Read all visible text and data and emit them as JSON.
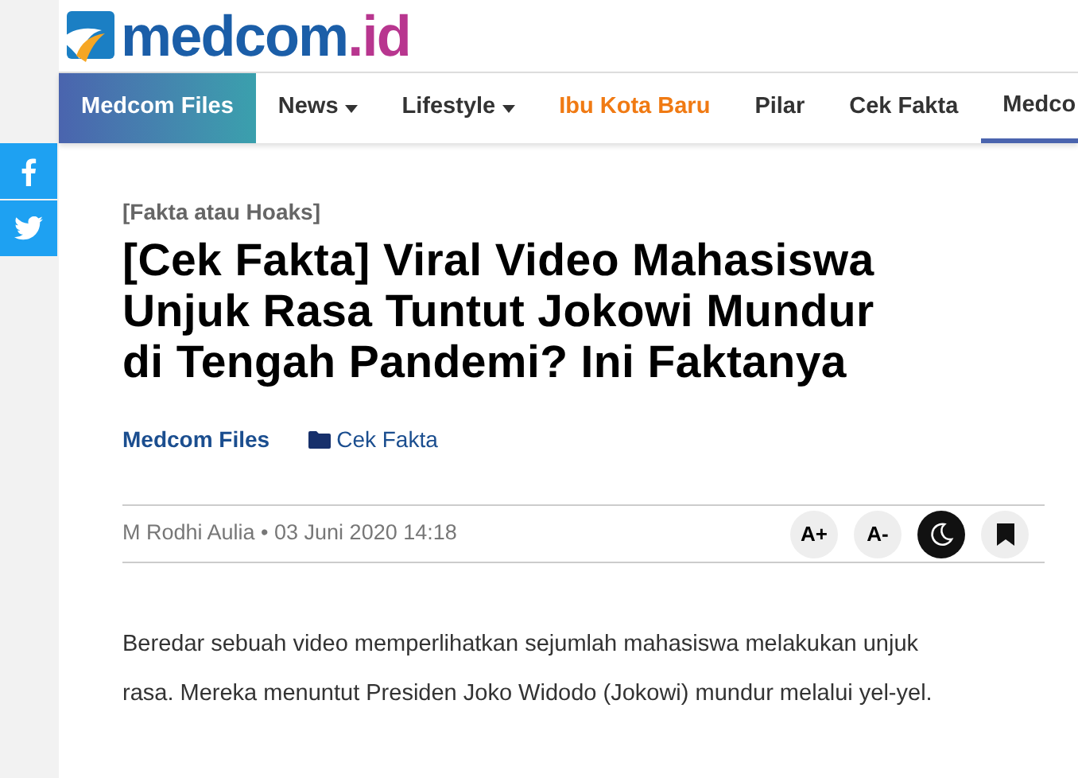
{
  "logo": {
    "text_main": "medcom",
    "text_suffix": ".id"
  },
  "nav": [
    {
      "label": "Medcom Files",
      "selected": true,
      "dropdown": false,
      "accent": false,
      "underlined": false
    },
    {
      "label": "News",
      "selected": false,
      "dropdown": true,
      "accent": false,
      "underlined": false
    },
    {
      "label": "Lifestyle",
      "selected": false,
      "dropdown": true,
      "accent": false,
      "underlined": false
    },
    {
      "label": "Ibu Kota Baru",
      "selected": false,
      "dropdown": false,
      "accent": true,
      "underlined": false
    },
    {
      "label": "Pilar",
      "selected": false,
      "dropdown": false,
      "accent": false,
      "underlined": false
    },
    {
      "label": "Cek Fakta",
      "selected": false,
      "dropdown": false,
      "accent": false,
      "underlined": false
    },
    {
      "label": "Medco",
      "selected": false,
      "dropdown": false,
      "accent": false,
      "underlined": true
    }
  ],
  "share": [
    {
      "kind": "facebook"
    },
    {
      "kind": "twitter"
    }
  ],
  "article": {
    "kicker": "[Fakta atau Hoaks]",
    "title": "[Cek Fakta] Viral Video Mahasiswa Unjuk Rasa Tuntut Jokowi Mundur di Tengah Pandemi? Ini Faktanya",
    "channel": "Medcom Files",
    "category": "Cek Fakta",
    "byline": "M Rodhi Aulia • 03 Juni 2020 14:18",
    "tools": [
      {
        "kind": "font_up",
        "label": "A+"
      },
      {
        "kind": "font_down",
        "label": "A-"
      },
      {
        "kind": "night"
      },
      {
        "kind": "bookmark"
      }
    ],
    "body": "Beredar sebuah video memperlihatkan sejumlah mahasiswa melakukan unjuk rasa. Mereka menuntut Presiden Joko Widodo (Jokowi) mundur melalui yel-yel."
  }
}
